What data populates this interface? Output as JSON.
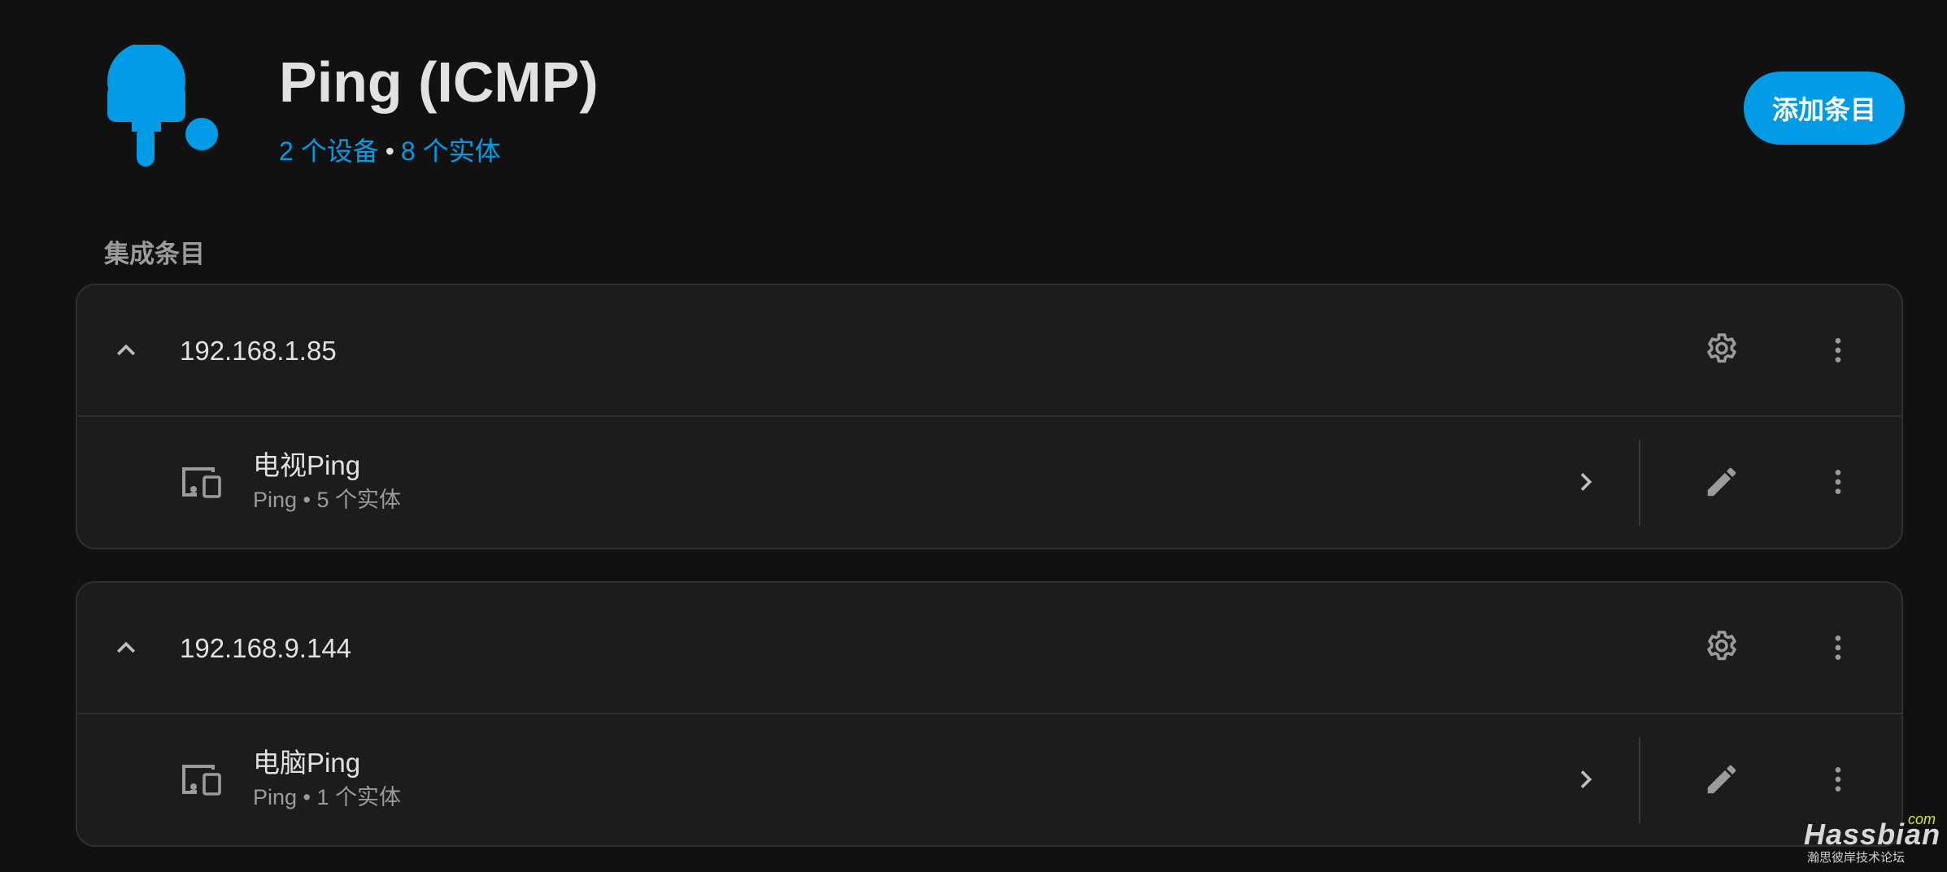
{
  "header": {
    "title": "Ping (ICMP)",
    "devices_link": "2 个设备",
    "separator": "•",
    "entities_link": "8 个实体",
    "add_button": "添加条目",
    "logo_icon": "ping-pong-paddle-icon",
    "accent_color": "#039be5"
  },
  "section": {
    "label": "集成条目"
  },
  "entries": [
    {
      "title": "192.168.1.85",
      "device": {
        "name": "电视Ping",
        "meta": "Ping • 5 个实体"
      }
    },
    {
      "title": "192.168.9.144",
      "device": {
        "name": "电脑Ping",
        "meta": "Ping • 1 个实体"
      }
    }
  ],
  "watermark": {
    "com": "com",
    "brand": "Hassbian",
    "sub": "瀚思彼岸技术论坛"
  }
}
